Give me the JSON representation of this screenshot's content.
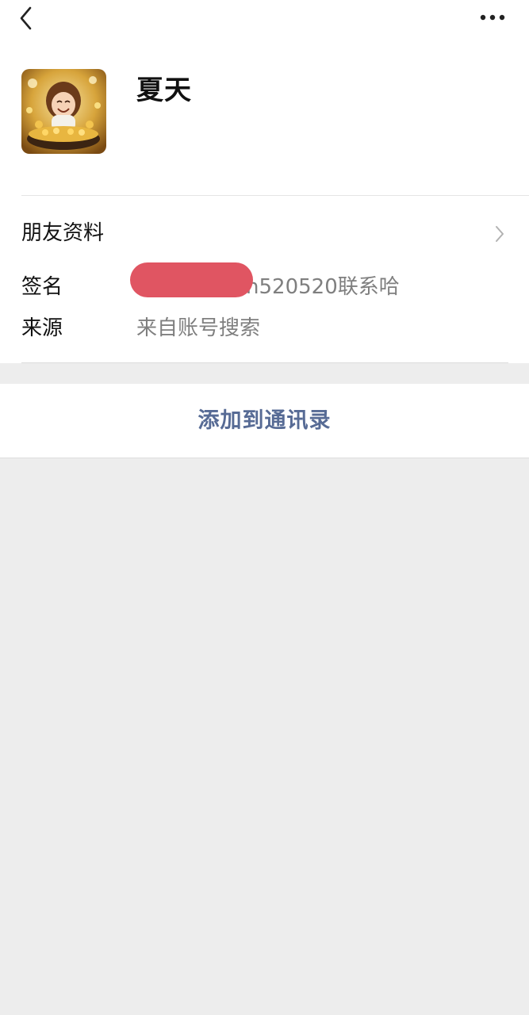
{
  "profile": {
    "nickname": "夏天",
    "avatar_icon": "avatar-anime-girl-gold"
  },
  "nav": {
    "back_icon": "back-arrow-icon",
    "more_icon": "more-dots-icon"
  },
  "friend_info": {
    "label": "朋友资料",
    "chevron_icon": "chevron-right-icon"
  },
  "fields": {
    "signature": {
      "label": "签名",
      "value": "n520520联系哈"
    },
    "source": {
      "label": "来源",
      "value": "来自账号搜索"
    }
  },
  "actions": {
    "add_to_contacts": "添加到通讯录"
  },
  "colors": {
    "background": "#ededed",
    "card": "#ffffff",
    "link_blue": "#576b95",
    "secondary_text": "#7f7f7f",
    "redaction": "#e05562"
  }
}
